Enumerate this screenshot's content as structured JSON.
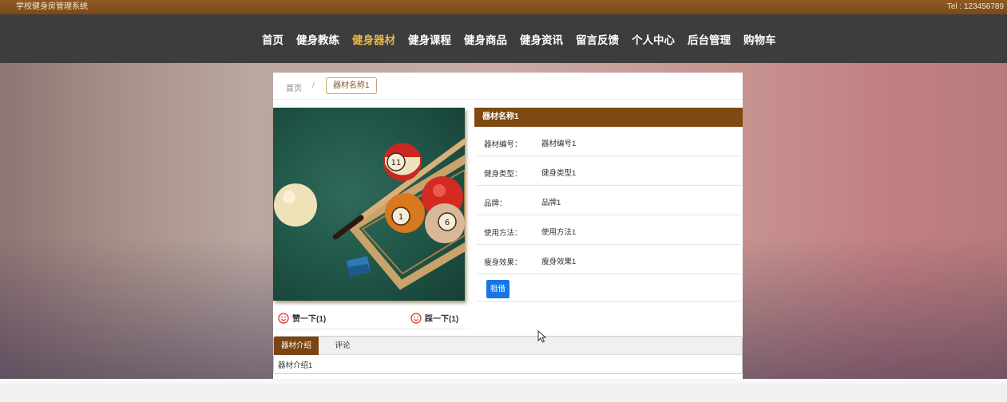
{
  "topbar": {
    "site_title": "学校健身房管理系统",
    "tel": "Tel : 123456789"
  },
  "nav": {
    "items": [
      "首页",
      "健身教练",
      "健身器材",
      "健身课程",
      "健身商品",
      "健身资讯",
      "留言反馈",
      "个人中心",
      "后台管理",
      "购物车"
    ],
    "active": "健身器材"
  },
  "breadcrumb": {
    "home": "首页",
    "separator": "/",
    "current": "器材名称1"
  },
  "detail": {
    "name": "器材名称1",
    "rows": [
      {
        "label": "器材编号：",
        "value": "器材编号1"
      },
      {
        "label": "健身类型：",
        "value": "健身类型1"
      },
      {
        "label": "品牌：",
        "value": "品牌1"
      },
      {
        "label": "使用方法：",
        "value": "使用方法1"
      },
      {
        "label": "瘦身效果：",
        "value": "瘦身效果1"
      }
    ],
    "rent_button": "租借"
  },
  "votes": {
    "like": "赞一下(1)",
    "dislike": "踩一下(1)"
  },
  "tabs": {
    "items": [
      "器材介绍",
      "评论"
    ],
    "active": "器材介绍",
    "content": "器材介绍1"
  },
  "colors": {
    "brand_brown": "#7e4a14",
    "nav_active": "#e8b84a",
    "button_blue": "#1677e5"
  },
  "icons": {
    "vote": "smiley-face-icon",
    "pointer": "mouse-cursor-icon"
  }
}
